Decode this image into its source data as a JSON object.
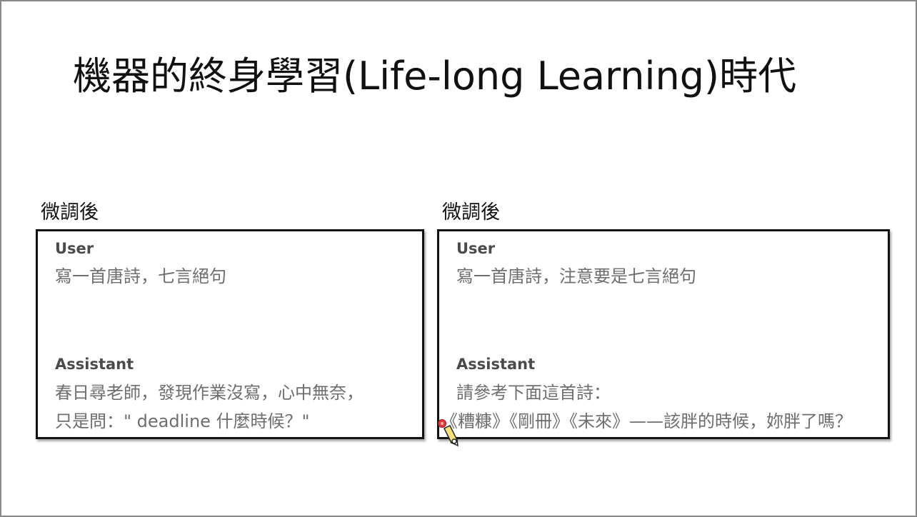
{
  "slide": {
    "title": "機器的終身學習(Life-long Learning)時代"
  },
  "left_panel": {
    "caption": "微調後",
    "user_role": "User",
    "user_message": "寫一首唐詩，七言絕句",
    "assistant_role": "Assistant",
    "assistant_line1": "春日尋老師，發現作業沒寫，心中無奈，",
    "assistant_line2": "只是問：\" deadline 什麼時候？\""
  },
  "right_panel": {
    "caption": "微調後",
    "user_role": "User",
    "user_message": "寫一首唐詩，注意要是七言絕句",
    "assistant_role": "Assistant",
    "assistant_line1": "請參考下面這首詩：",
    "assistant_line2": "《糟糠》《剛冊》《未來》——該胖的時候，妳胖了嗎？"
  },
  "colors": {
    "panel_border": "#111111",
    "role_text": "#4a4a4a",
    "message_text": "#6e6e6e",
    "title_text": "#111111"
  },
  "icons": {
    "cursor": "pen-cursor-icon"
  }
}
